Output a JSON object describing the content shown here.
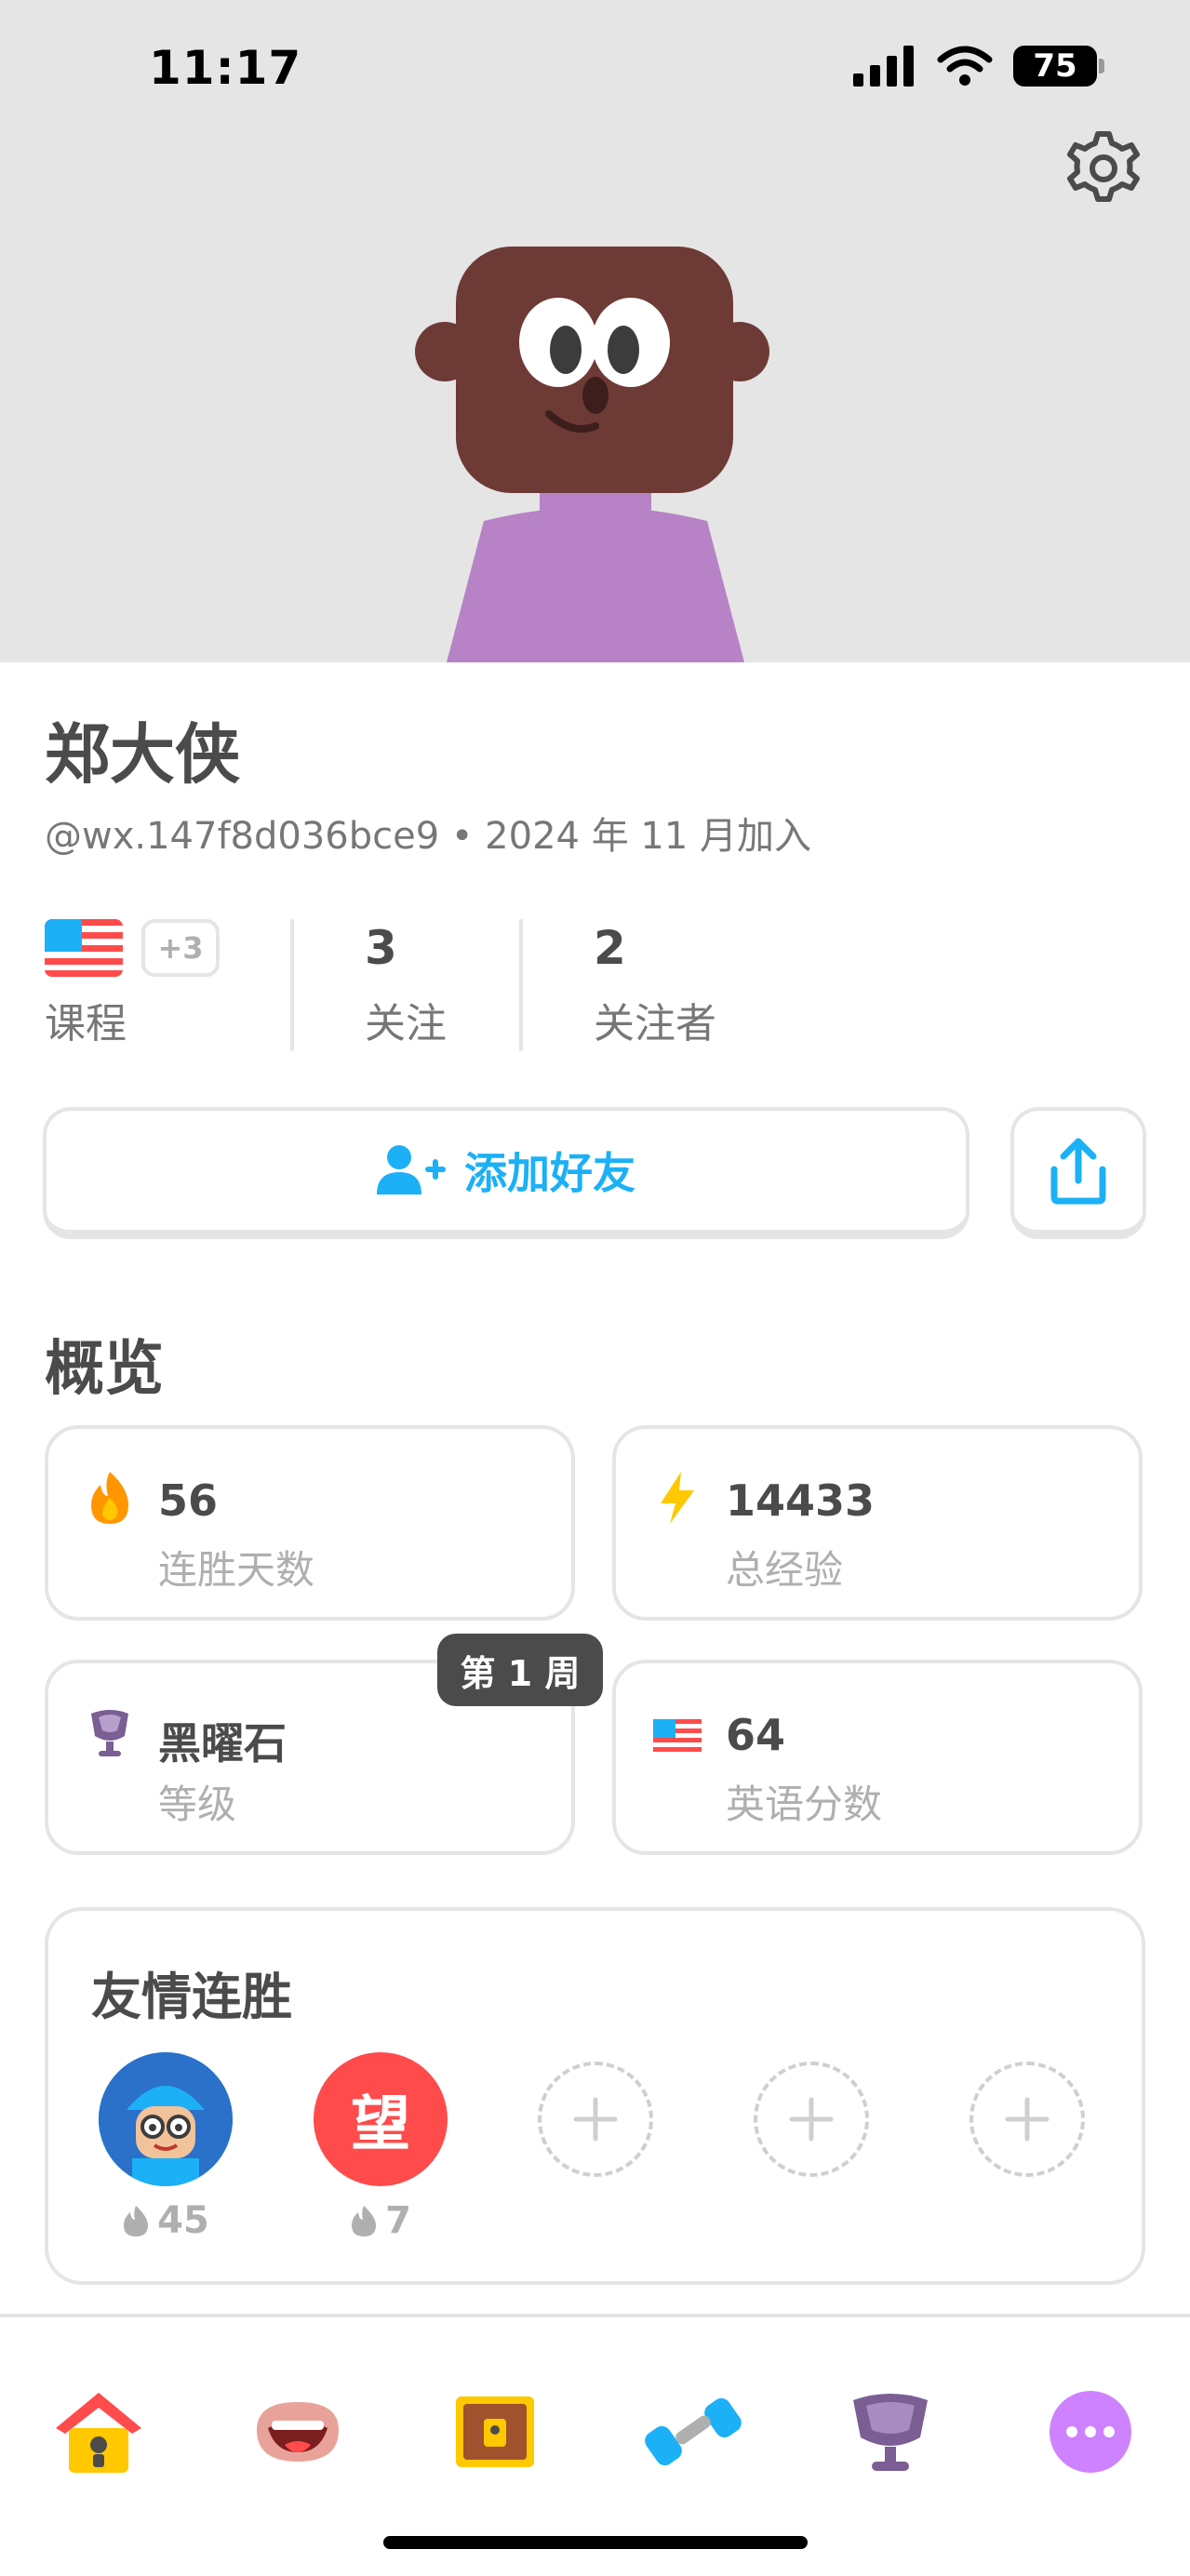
{
  "status_bar": {
    "time": "11:17",
    "battery": "75"
  },
  "header": {
    "settings_icon": "gear-icon"
  },
  "profile": {
    "name": "郑大侠",
    "handle_line": "@wx.147f8d036bce9 • 2024 年 11 月加入"
  },
  "stats": {
    "courses_extra": "+3",
    "courses_label": "课程",
    "following_count": "3",
    "following_label": "关注",
    "followers_count": "2",
    "followers_label": "关注者"
  },
  "actions": {
    "add_friend_label": "添加好友",
    "share_icon": "share-icon"
  },
  "overview": {
    "title": "概览",
    "streak_value": "56",
    "streak_label": "连胜天数",
    "xp_value": "14433",
    "xp_label": "总经验",
    "league_value": "黑曜石",
    "league_label": "等级",
    "week_badge": "第 1 周",
    "score_value": "64",
    "score_label": "英语分数"
  },
  "friend_streaks": {
    "title": "友情连胜",
    "friends": [
      {
        "streak": "45"
      },
      {
        "initial": "望",
        "streak": "7"
      }
    ]
  },
  "colors": {
    "accent_blue": "#1cb0f6",
    "header_bg": "#e5e5e5",
    "friend_red": "#ff4b4b",
    "more_purple": "#ce82ff"
  },
  "tabbar": {
    "items": [
      "home-icon",
      "speak-icon",
      "chest-icon",
      "practice-icon",
      "league-icon",
      "more-icon"
    ]
  }
}
